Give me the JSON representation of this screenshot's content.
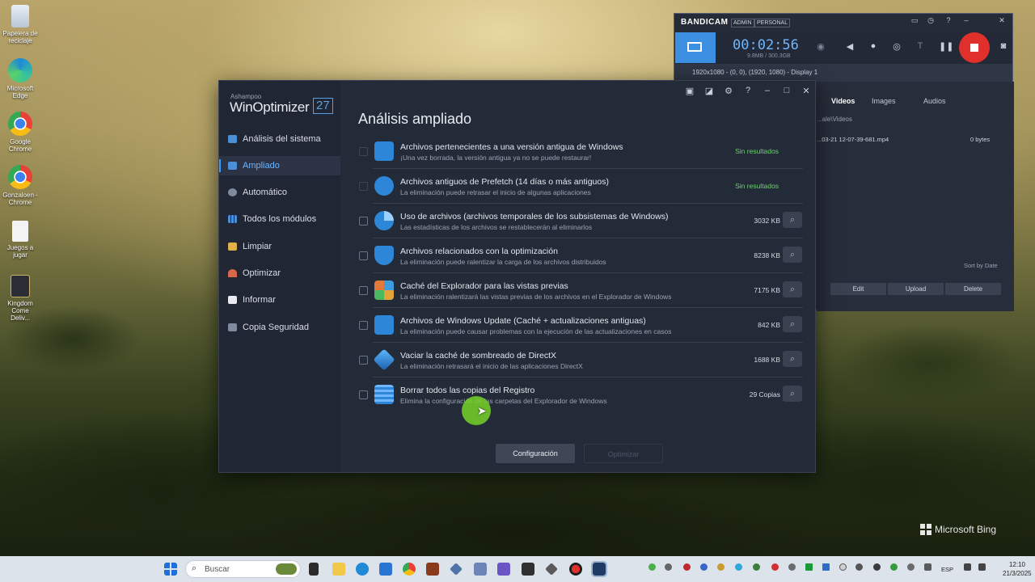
{
  "desktop": {
    "icons": [
      {
        "label": "Papelera de reciclaje",
        "icon": "recycle-bin-icon"
      },
      {
        "label": "Microsoft Edge",
        "icon": "edge-icon"
      },
      {
        "label": "Google Chrome",
        "icon": "chrome-icon"
      },
      {
        "label": "Gonzaloen - Chrome",
        "icon": "chrome-profile-icon"
      },
      {
        "label": "Juegos a jugar",
        "icon": "text-file-icon"
      },
      {
        "label": "Kingdom Come Deliv...",
        "icon": "game-icon"
      }
    ],
    "watermark": "Microsoft Bing"
  },
  "winoptimizer": {
    "brand_small": "Ashampoo",
    "brand": "WinOptimizer",
    "version": "27",
    "sidebar": [
      {
        "label": "Análisis del sistema",
        "icon": "monitor-icon"
      },
      {
        "label": "Ampliado",
        "icon": "chart-icon",
        "active": true
      },
      {
        "label": "Automático",
        "icon": "gear-icon"
      },
      {
        "label": "Todos los módulos",
        "icon": "grid-icon"
      },
      {
        "label": "Limpiar",
        "icon": "broom-icon"
      },
      {
        "label": "Optimizar",
        "icon": "gauge-icon"
      },
      {
        "label": "Informar",
        "icon": "checkbox-icon"
      },
      {
        "label": "Copia Seguridad",
        "icon": "backup-icon"
      }
    ],
    "title": "Análisis ampliado",
    "items": [
      {
        "title": "Archivos pertenecientes a una versión antigua de Windows",
        "desc": "¡Una vez borrada, la versión antigua ya no se puede restaurar!",
        "value": "Sin resultados",
        "found": false
      },
      {
        "title": "Archivos antiguos de Prefetch (14 días o más antiguos)",
        "desc": "La eliminación puede retrasar el inicio de algunas aplicaciones",
        "value": "Sin resultados",
        "found": false
      },
      {
        "title": "Uso de archivos (archivos temporales de los subsistemas de Windows)",
        "desc": "Las estadísticas de los archivos se restablecerán al eliminarlos",
        "value": "3032 KB",
        "found": true
      },
      {
        "title": "Archivos relacionados con la optimización",
        "desc": "La eliminación puede ralentizar la carga de los archivos distribuidos",
        "value": "8238 KB",
        "found": true
      },
      {
        "title": "Caché del Explorador para las vistas previas",
        "desc": "La eliminación ralentizará las vistas previas de los archivos en el Explorador de Windows",
        "value": "7175 KB",
        "found": true
      },
      {
        "title": "Archivos de Windows Update (Caché + actualizaciones antiguas)",
        "desc": "La eliminación puede causar problemas con la ejecución de las actualizaciones en casos",
        "value": "842 KB",
        "found": true
      },
      {
        "title": "Vaciar la caché de sombreado de DirectX",
        "desc": "La eliminación retrasará el inicio de las aplicaciones DirectX",
        "value": "1688 KB",
        "found": true
      },
      {
        "title": "Borrar todos las copias del Registro",
        "desc": "Elimina la configuración de las carpetas del Explorador de Windows",
        "value": "29 Copias",
        "found": true
      }
    ],
    "buttons": {
      "config": "Configuración",
      "optimize": "Optimizar"
    },
    "colors": {
      "accent": "#3c9bff",
      "ok": "#6bd36b",
      "bg": "#242b38"
    }
  },
  "bandicam": {
    "logo": "BANDICAM",
    "tags": [
      "ADMIN",
      "PERSONAL"
    ],
    "timer": "00:02:56",
    "size": "9.8MB / 300.3GB",
    "target": "1920x1080 - (0, 0), (1920, 1080) - Display 1",
    "tabs": [
      "Videos",
      "Images",
      "Audios"
    ],
    "path": "...ale\\Videos",
    "file": {
      "name": "...03-21 12-07-39-681.mp4",
      "size": "0 bytes"
    },
    "sort": "Sort by Date",
    "buttons": [
      "Edit",
      "Upload",
      "Delete"
    ]
  },
  "taskbar": {
    "search_placeholder": "Buscar",
    "lang": "ESP",
    "time": "12:10",
    "date": "21/3/2025"
  }
}
